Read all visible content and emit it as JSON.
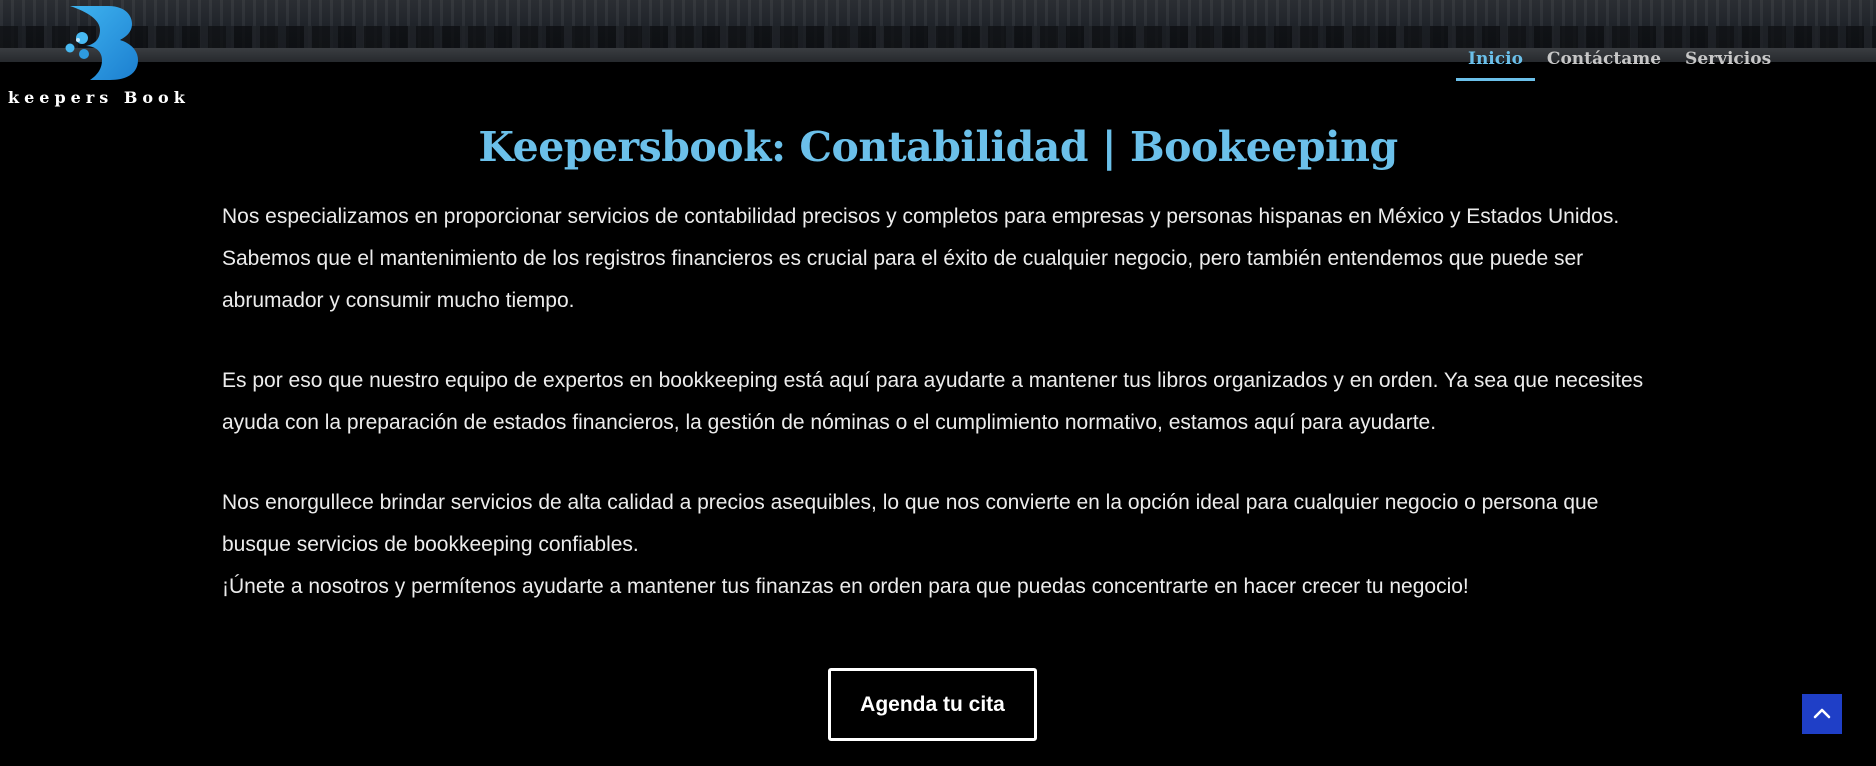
{
  "brand": {
    "logo_text": "keepers Book",
    "accent_color": "#6bc0ea"
  },
  "nav": {
    "items": [
      {
        "label": "Inicio",
        "active": true
      },
      {
        "label": "Contáctame",
        "active": false
      },
      {
        "label": "Servicios",
        "active": false
      }
    ]
  },
  "main": {
    "title": "Keepersbook: Contabilidad | Bookeeping",
    "paragraphs": [
      "Nos especializamos en proporcionar servicios de contabilidad precisos y completos para empresas y personas hispanas en México y Estados Unidos. Sabemos que el mantenimiento de los registros financieros es crucial para el éxito de cualquier negocio, pero también entendemos que puede ser abrumador y consumir mucho tiempo.",
      "Es por eso que nuestro equipo de expertos en bookkeeping está aquí para ayudarte a mantener tus libros organizados y en orden. Ya sea que necesites ayuda con la preparación de estados financieros, la gestión de nóminas o el cumplimiento normativo, estamos aquí para ayudarte.",
      "Nos enorgullece brindar servicios de alta calidad a precios asequibles, lo que nos convierte en la opción ideal para cualquier negocio o persona que busque servicios de bookkeeping confiables.",
      "¡Únete a nosotros y permítenos ayudarte a mantener tus finanzas en orden para que puedas concentrarte en hacer crecer tu negocio!"
    ],
    "cta_label": "Agenda tu cita"
  },
  "icons": {
    "logo": "b-logo-icon",
    "back_to_top": "chevron-up-icon"
  }
}
